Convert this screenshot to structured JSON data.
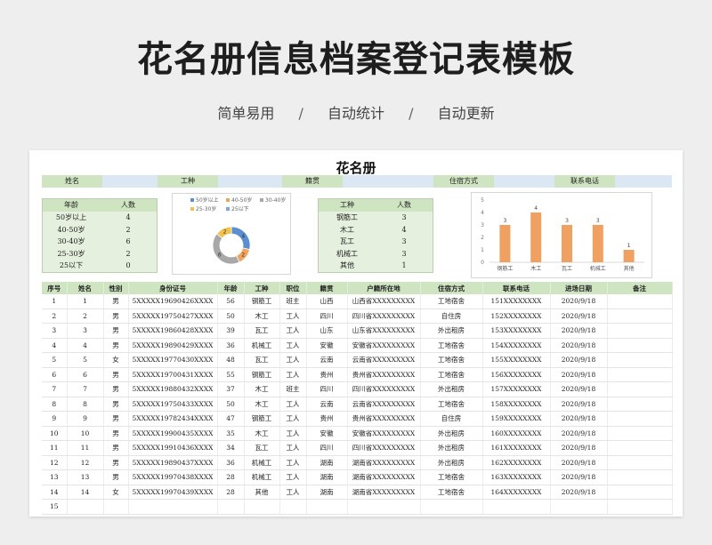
{
  "header": {
    "title": "花名册信息档案登记表模板",
    "features": [
      "简单易用",
      "自动统计",
      "自动更新"
    ],
    "separator": "/"
  },
  "sheet": {
    "title": "花名册",
    "info_labels": [
      "姓名",
      "工种",
      "籍贯",
      "住宿方式",
      "联系电话"
    ]
  },
  "age_table": {
    "headers": [
      "年龄",
      "人数"
    ],
    "rows": [
      [
        "50岁以上",
        "4"
      ],
      [
        "40-50岁",
        "2"
      ],
      [
        "30-40岁",
        "6"
      ],
      [
        "25-30岁",
        "2"
      ],
      [
        "25以下",
        "0"
      ]
    ]
  },
  "job_table": {
    "headers": [
      "工种",
      "人数"
    ],
    "rows": [
      [
        "钢筋工",
        "3"
      ],
      [
        "木工",
        "4"
      ],
      [
        "瓦工",
        "3"
      ],
      [
        "机械工",
        "3"
      ],
      [
        "其他",
        "1"
      ]
    ]
  },
  "chart_data": [
    {
      "type": "pie",
      "variant": "donut",
      "legend": [
        "50岁以上",
        "40-50岁",
        "30-40岁",
        "25-30岁",
        "25以下"
      ],
      "values": [
        4,
        2,
        6,
        2,
        0
      ],
      "data_labels": [
        "4",
        "2",
        "6",
        "2"
      ],
      "colors": [
        "#5b8fd0",
        "#f0a35b",
        "#a8a8a8",
        "#f2c14e",
        "#7aa6d8"
      ],
      "legend_position": "top"
    },
    {
      "type": "bar",
      "categories": [
        "钢筋工",
        "木工",
        "瓦工",
        "机械工",
        "其他"
      ],
      "values": [
        3,
        4,
        3,
        3,
        1
      ],
      "yticks": [
        "0",
        "1",
        "2",
        "3",
        "4",
        "5"
      ],
      "ylim": [
        0,
        5
      ],
      "color": "#f0a060",
      "grid": false
    }
  ],
  "roster": {
    "columns": [
      "序号",
      "姓名",
      "性别",
      "身份证号",
      "年龄",
      "工种",
      "职位",
      "籍贯",
      "户籍所在地",
      "住宿方式",
      "联系电话",
      "进场日期",
      "备注"
    ],
    "rows": [
      [
        "1",
        "1",
        "男",
        "5XXXXX19690426XXXX",
        "56",
        "钢筋工",
        "班主",
        "山西",
        "山西省XXXXXXXXX",
        "工地宿舍",
        "151XXXXXXXX",
        "2020/9/18",
        ""
      ],
      [
        "2",
        "2",
        "男",
        "5XXXXX19750427XXXX",
        "50",
        "木工",
        "工人",
        "四川",
        "四川省XXXXXXXXX",
        "自住房",
        "152XXXXXXXX",
        "2020/9/18",
        ""
      ],
      [
        "3",
        "3",
        "男",
        "5XXXXX19860428XXXX",
        "39",
        "瓦工",
        "工人",
        "山东",
        "山东省XXXXXXXXX",
        "外出租房",
        "153XXXXXXXX",
        "2020/9/18",
        ""
      ],
      [
        "4",
        "4",
        "男",
        "5XXXXX19890429XXXX",
        "36",
        "机械工",
        "工人",
        "安徽",
        "安徽省XXXXXXXXX",
        "工地宿舍",
        "154XXXXXXXX",
        "2020/9/18",
        ""
      ],
      [
        "5",
        "5",
        "女",
        "5XXXXX19770430XXXX",
        "48",
        "瓦工",
        "工人",
        "云南",
        "云南省XXXXXXXXX",
        "工地宿舍",
        "155XXXXXXXX",
        "2020/9/18",
        ""
      ],
      [
        "6",
        "6",
        "男",
        "5XXXXX19700431XXXX",
        "55",
        "钢筋工",
        "工人",
        "贵州",
        "贵州省XXXXXXXXX",
        "工地宿舍",
        "156XXXXXXXX",
        "2020/9/18",
        ""
      ],
      [
        "7",
        "7",
        "男",
        "5XXXXX19880432XXXX",
        "37",
        "木工",
        "班主",
        "四川",
        "四川省XXXXXXXXX",
        "外出租房",
        "157XXXXXXXX",
        "2020/9/18",
        ""
      ],
      [
        "8",
        "8",
        "男",
        "5XXXXX19750433XXXX",
        "50",
        "木工",
        "工人",
        "云南",
        "云南省XXXXXXXXX",
        "工地宿舍",
        "158XXXXXXXX",
        "2020/9/18",
        ""
      ],
      [
        "9",
        "9",
        "男",
        "5XXXXX19782434XXXX",
        "47",
        "钢筋工",
        "工人",
        "贵州",
        "贵州省XXXXXXXXX",
        "自住房",
        "159XXXXXXXX",
        "2020/9/18",
        ""
      ],
      [
        "10",
        "10",
        "男",
        "5XXXXX19900435XXXX",
        "35",
        "木工",
        "工人",
        "安徽",
        "安徽省XXXXXXXXX",
        "外出租房",
        "160XXXXXXXX",
        "2020/9/18",
        ""
      ],
      [
        "11",
        "11",
        "男",
        "5XXXXX19910436XXXX",
        "34",
        "瓦工",
        "工人",
        "四川",
        "四川省XXXXXXXXX",
        "外出租房",
        "161XXXXXXXX",
        "2020/9/18",
        ""
      ],
      [
        "12",
        "12",
        "男",
        "5XXXXX19890437XXXX",
        "36",
        "机械工",
        "工人",
        "湖南",
        "湖南省XXXXXXXXX",
        "外出租房",
        "162XXXXXXXX",
        "2020/9/18",
        ""
      ],
      [
        "13",
        "13",
        "男",
        "5XXXXX19970438XXXX",
        "28",
        "机械工",
        "工人",
        "湖南",
        "湖南省XXXXXXXXX",
        "工地宿舍",
        "163XXXXXXXX",
        "2020/9/18",
        ""
      ],
      [
        "14",
        "14",
        "女",
        "5XXXXX19970439XXXX",
        "28",
        "其他",
        "工人",
        "湖南",
        "湖南省XXXXXXXXX",
        "工地宿舍",
        "164XXXXXXXX",
        "2020/9/18",
        ""
      ],
      [
        "15",
        "",
        "",
        "",
        "",
        "",
        "",
        "",
        "",
        "",
        "",
        "",
        ""
      ]
    ]
  }
}
